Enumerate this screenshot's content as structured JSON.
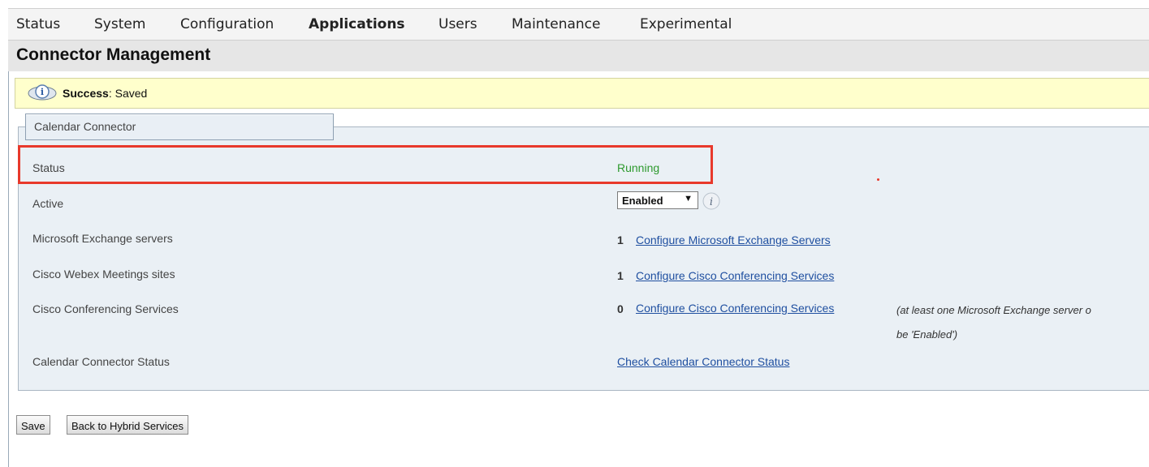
{
  "nav": {
    "items": [
      {
        "label": "Status"
      },
      {
        "label": "System"
      },
      {
        "label": "Configuration"
      },
      {
        "label": "Applications",
        "active": true
      },
      {
        "label": "Users"
      },
      {
        "label": "Maintenance"
      },
      {
        "label": "Experimental"
      }
    ]
  },
  "page": {
    "title": "Connector Management"
  },
  "banner": {
    "status_word": "Success",
    "message": ": Saved",
    "icon": "info-icon"
  },
  "section": {
    "legend": "Calendar Connector"
  },
  "rows": {
    "status": {
      "label": "Status",
      "value": "Running",
      "value_color": "#2e9a2e"
    },
    "active": {
      "label": "Active",
      "selected": "Enabled"
    },
    "exchange": {
      "label": "Microsoft Exchange servers",
      "count": "1",
      "link": "Configure Microsoft Exchange Servers"
    },
    "webex": {
      "label": "Cisco Webex Meetings sites",
      "count": "1",
      "link": "Configure Cisco Conferencing Services"
    },
    "conferencing": {
      "label": "Cisco Conferencing Services",
      "count": "0",
      "link": "Configure Cisco Conferencing Services",
      "note_line1": "(at least one Microsoft Exchange server o",
      "note_line2": "be 'Enabled')"
    },
    "connector_status": {
      "label": "Calendar Connector Status",
      "link": "Check Calendar Connector Status"
    }
  },
  "buttons": {
    "save": "Save",
    "back": "Back to Hybrid Services"
  },
  "colors": {
    "highlight": "#e8392b",
    "banner_bg": "#ffffcc",
    "panel_bg": "#eaf0f5",
    "link": "#1f4fa0"
  }
}
